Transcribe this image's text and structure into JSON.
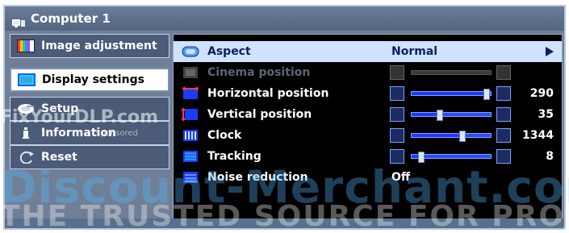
{
  "window": {
    "title": "Computer 1"
  },
  "sidebar": {
    "items": [
      {
        "label": "Image adjustment",
        "active": false,
        "icon": "color-bars-icon"
      },
      {
        "label": "Display settings",
        "active": true,
        "icon": "display-icon"
      },
      {
        "label": "Setup",
        "active": false,
        "icon": "setup-disk-icon"
      },
      {
        "label": "Information",
        "active": false,
        "icon": "info-icon"
      },
      {
        "label": "Reset",
        "active": false,
        "icon": "reset-icon"
      }
    ]
  },
  "panel": {
    "rows": [
      {
        "label": "Aspect",
        "value": "Normal",
        "selected": true,
        "disabled": false,
        "type": "value",
        "icon": "aspect-icon"
      },
      {
        "label": "Cinema position",
        "value": "",
        "selected": false,
        "disabled": true,
        "type": "slider",
        "icon": "cinema-position-icon",
        "slider_level": 0.0
      },
      {
        "label": "Horizontal position",
        "value": "290",
        "selected": false,
        "disabled": false,
        "type": "slider",
        "icon": "horizontal-position-icon",
        "slider_level": 0.93
      },
      {
        "label": "Vertical position",
        "value": "35",
        "selected": false,
        "disabled": false,
        "type": "slider",
        "icon": "vertical-position-icon",
        "slider_level": 0.35
      },
      {
        "label": "Clock",
        "value": "1344",
        "selected": false,
        "disabled": false,
        "type": "slider",
        "icon": "clock-icon",
        "slider_level": 0.63
      },
      {
        "label": "Tracking",
        "value": "8",
        "selected": false,
        "disabled": false,
        "type": "slider",
        "icon": "tracking-icon",
        "slider_level": 0.12
      },
      {
        "label": "Noise reduction",
        "value": "Off",
        "selected": false,
        "disabled": false,
        "type": "value",
        "icon": "noise-reduction-icon"
      }
    ]
  },
  "watermark": {
    "line1": "FixYourDLP.com",
    "sponsored": "Sponsored",
    "line2": "Discount-Merchant.com",
    "line3": "THE TRUSTED SOURCE FOR PROJECTOR"
  },
  "colors": {
    "frame": "#6f7f98",
    "title": "#53657f",
    "sidebar_bg": "#4b5b78",
    "active_bg": "#ffffff",
    "panel_bg": "#000000",
    "selected_row": "#cfe2ff",
    "slider_blue": "#2a4dff"
  }
}
